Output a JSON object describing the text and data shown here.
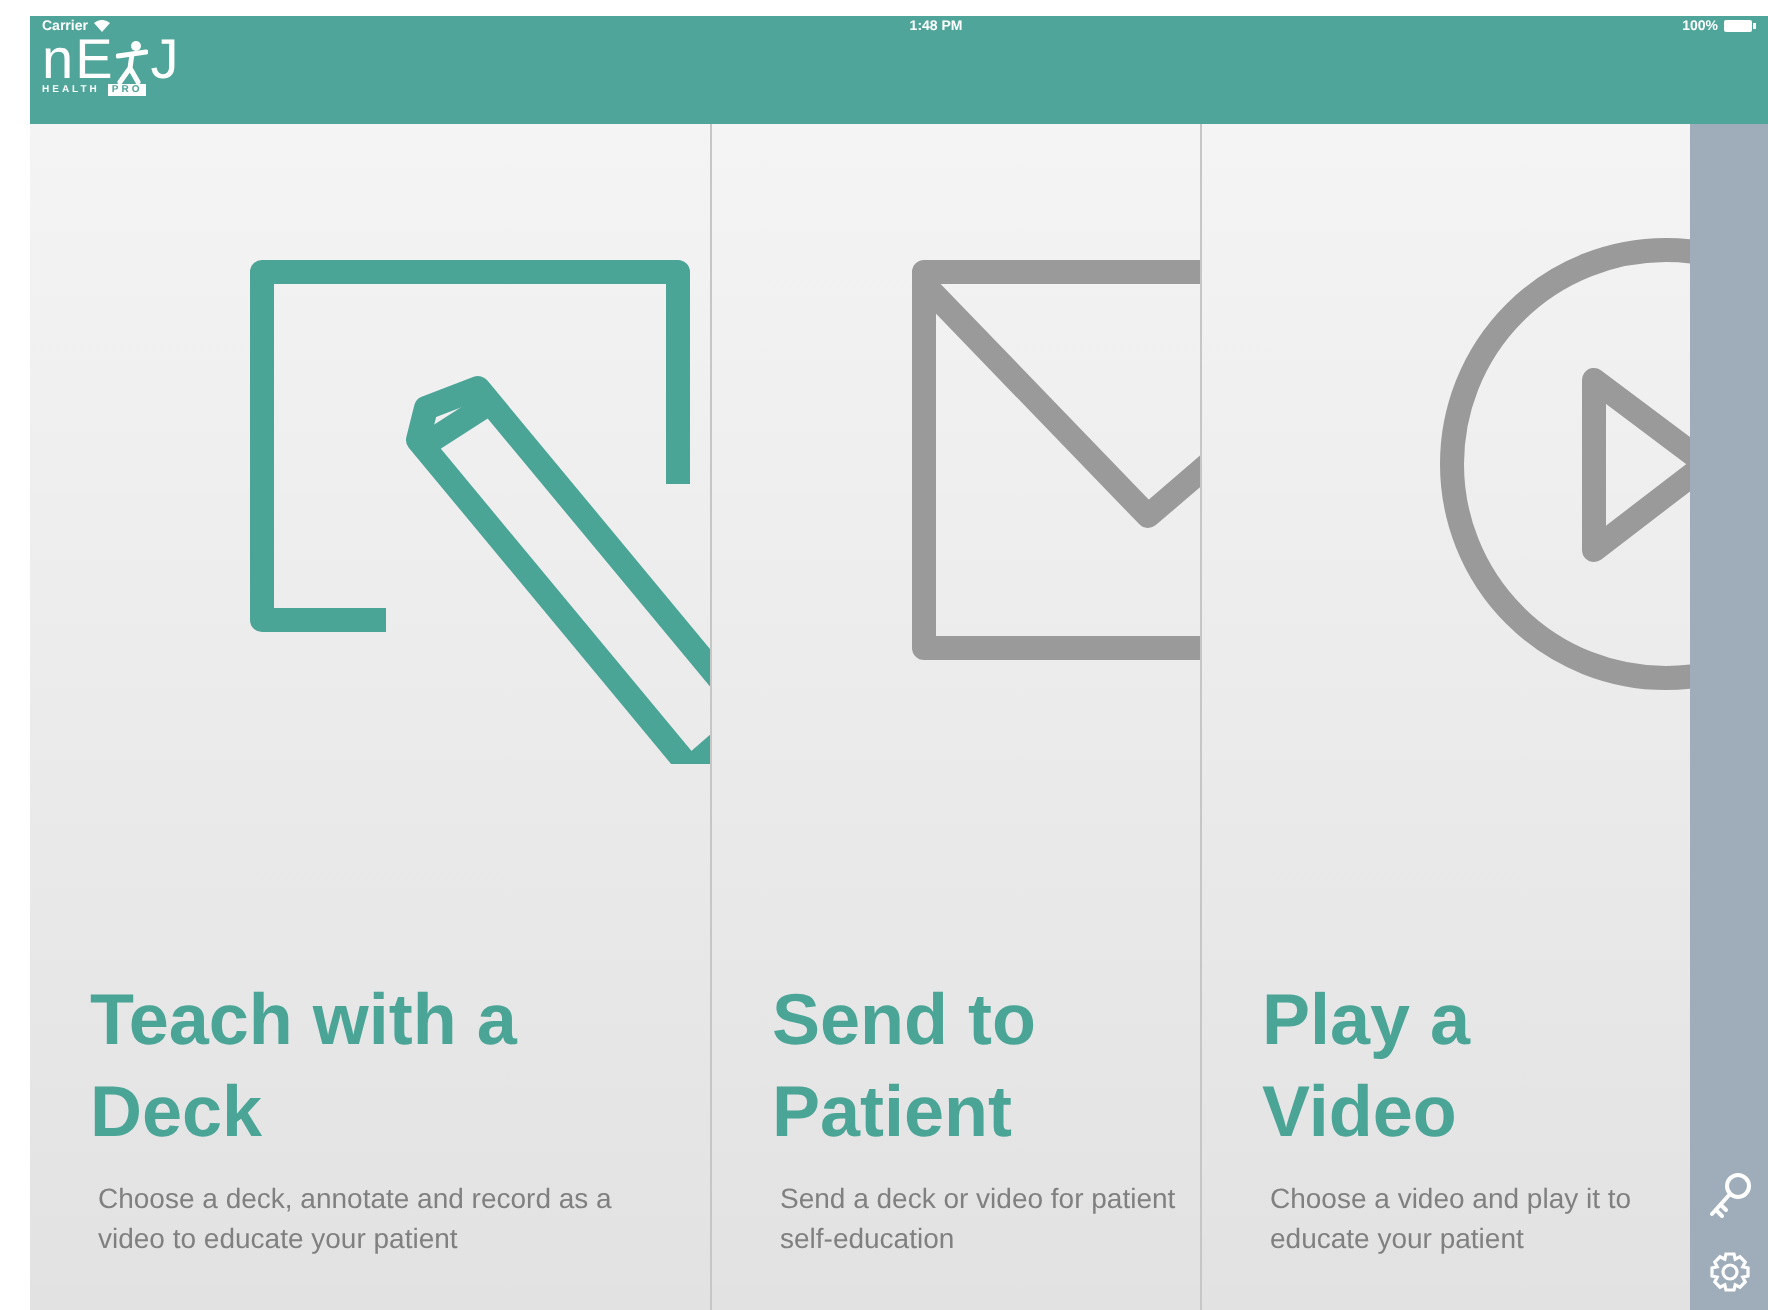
{
  "status_bar": {
    "carrier": "Carrier",
    "time": "1:48 PM",
    "battery": "100%"
  },
  "logo": {
    "wordmark_start": "nE",
    "wordmark_end": "J",
    "tagline": "HEALTH",
    "badge": "PRO"
  },
  "panels": [
    {
      "kind": "deck",
      "selected": true,
      "title": "Teach with a Deck",
      "description": "Choose a deck, annotate and record as a video to educate your patient"
    },
    {
      "kind": "send",
      "selected": false,
      "title": "Send to Patient",
      "description": "Send a deck or video for patient self-education"
    },
    {
      "kind": "video",
      "selected": false,
      "title": "Play a Video",
      "description": "Choose a video and play it to educate your patient"
    }
  ]
}
